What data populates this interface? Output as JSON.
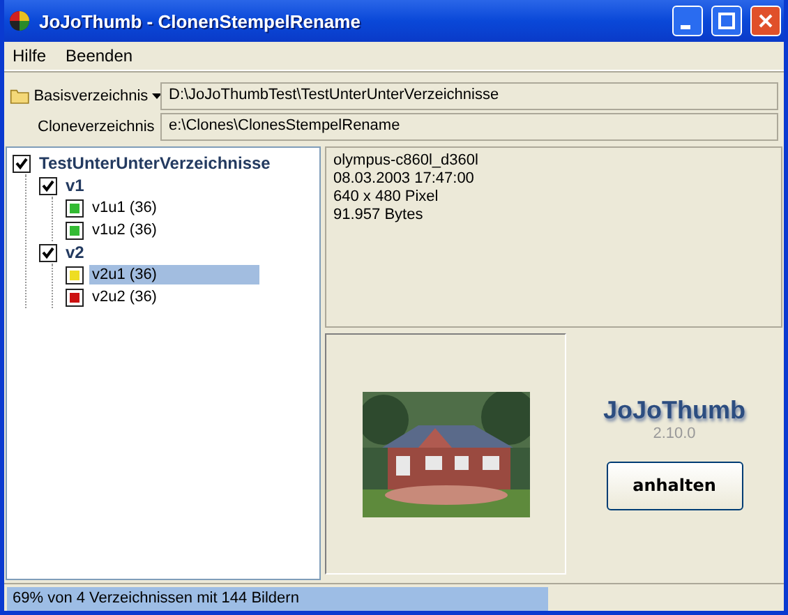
{
  "window": {
    "title": "JoJoThumb - ClonenStempelRename"
  },
  "menu": [
    "Hilfe",
    "Beenden"
  ],
  "paths": [
    {
      "kind": "dropdown",
      "label": "Basisverzeichnis",
      "value": "D:\\JoJoThumbTest\\TestUnterUnterVerzeichnisse"
    },
    {
      "kind": "plain",
      "label": "Cloneverzeichnis",
      "value": "e:\\Clones\\ClonesStempelRename"
    }
  ],
  "tree": [
    {
      "label": "TestUnterUnterVerzeichnisse",
      "kind": "folder",
      "checked": true,
      "selected": false,
      "children": [
        {
          "label": "v1",
          "kind": "folder",
          "checked": true,
          "selected": false,
          "children": [
            {
              "label": "v1u1 (36)",
              "kind": "leaf",
              "color": "#33bb33",
              "selected": false
            },
            {
              "label": "v1u2 (36)",
              "kind": "leaf",
              "color": "#33bb33",
              "selected": false
            }
          ]
        },
        {
          "label": "v2",
          "kind": "folder",
          "checked": true,
          "selected": false,
          "children": [
            {
              "label": "v2u1 (36)",
              "kind": "leaf",
              "color": "#eedd22",
              "selected": true
            },
            {
              "label": "v2u2 (36)",
              "kind": "leaf",
              "color": "#cc1111",
              "selected": false
            }
          ]
        }
      ]
    }
  ],
  "info": [
    "olympus-c860l_d360l",
    "08.03.2003 17:47:00",
    "640 x 480 Pixel",
    "91.957 Bytes"
  ],
  "logo": {
    "name": "JoJoThumb",
    "version": "2.10.0"
  },
  "button": "anhalten",
  "status": {
    "text": "69% von 4 Verzeichnissen mit 144 Bildern",
    "level": 0.69
  }
}
